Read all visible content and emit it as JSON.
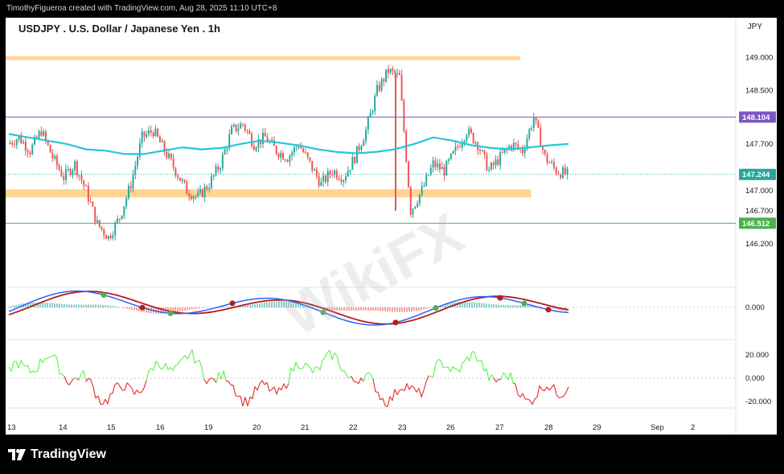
{
  "header": {
    "credit": "TimothyFigueroa created with TradingView.com, Aug 28, 2025 11:10 UTC+8"
  },
  "chart_header": {
    "title": "USDJPY . U.S. Dollar / Japanese Yen . 1h",
    "currency": "JPY"
  },
  "footer": {
    "brand": "TradingView"
  },
  "watermark": "WikiFX",
  "chart_data": [
    {
      "type": "candlestick",
      "title": "USDJPY . U.S. Dollar / Japanese Yen . 1h",
      "price_ticks": [
        "149.000",
        "148.500",
        "147.700",
        "147.000",
        "146.700",
        "146.200"
      ],
      "price_tick_values": [
        149.0,
        148.5,
        147.7,
        147.0,
        146.7,
        146.2
      ],
      "ylim": [
        145.55,
        149.45
      ],
      "x_ticks": [
        "13",
        "14",
        "15",
        "16",
        "19",
        "20",
        "21",
        "22",
        "23",
        "26",
        "27",
        "28",
        "29",
        "Sep",
        "2"
      ],
      "price_badges": [
        {
          "label": "148.104",
          "value": 148.104,
          "color": "#7e57c2"
        },
        {
          "label": "147.244",
          "value": 147.244,
          "color": "#26a69a"
        },
        {
          "label": "146.512",
          "value": 146.512,
          "color": "#4caf50"
        }
      ],
      "horizontal_lines": [
        {
          "value": 148.104,
          "color": "#7e57c2"
        },
        {
          "value": 146.512,
          "color": "#4caf50"
        }
      ],
      "zones": [
        {
          "from": 149.02,
          "to": 148.97,
          "color": "#ffcc80",
          "x_end_index": 0.705
        },
        {
          "from": 147.02,
          "to": 146.9,
          "color": "#ffcc80",
          "x_end_index": 0.72
        }
      ],
      "close_path": [
        147.7,
        147.8,
        147.6,
        147.9,
        147.5,
        147.2,
        147.4,
        147.0,
        146.5,
        146.3,
        146.6,
        147.1,
        147.8,
        147.9,
        147.6,
        147.3,
        147.0,
        146.9,
        147.1,
        147.4,
        147.9,
        148.0,
        147.7,
        147.8,
        147.6,
        147.5,
        147.7,
        147.4,
        147.1,
        147.3,
        147.2,
        147.5,
        147.9,
        148.5,
        148.8,
        148.7,
        146.7,
        147.0,
        147.4,
        147.3,
        147.6,
        147.9,
        147.7,
        147.3,
        147.5,
        147.7,
        147.6,
        148.1,
        147.5,
        147.3,
        147.24
      ],
      "moving_average": [
        147.85,
        147.8,
        147.75,
        147.7,
        147.62,
        147.6,
        147.55,
        147.55,
        147.6,
        147.65,
        147.62,
        147.64,
        147.7,
        147.75,
        147.72,
        147.68,
        147.62,
        147.58,
        147.56,
        147.58,
        147.62,
        147.7,
        147.8,
        147.75,
        147.68,
        147.64,
        147.62,
        147.65,
        147.68,
        147.7
      ]
    },
    {
      "type": "line",
      "name": "MACD",
      "ticks": [
        "0.000"
      ],
      "tick_values": [
        0
      ]
    },
    {
      "type": "line",
      "name": "oscillator",
      "ticks": [
        "20.000",
        "0.000",
        "-20.000"
      ],
      "tick_values": [
        20,
        0,
        -20
      ]
    }
  ],
  "colors": {
    "ma": "#26c6da",
    "macd": "#2962ff",
    "signal_up": "#4caf50",
    "signal_down": "#b71c1c",
    "osc_up": "#69f05a",
    "osc_down": "#e53935",
    "bull": "#26a69a",
    "bear": "#ef5350",
    "zone": "#ffcc80"
  }
}
